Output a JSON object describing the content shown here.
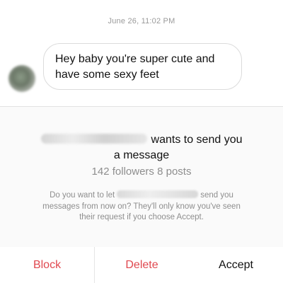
{
  "thread": {
    "timestamp": "June 26, 11:02 PM",
    "message_line1": "Hey baby you're super cute and",
    "message_line2": "have some sexy feet"
  },
  "request": {
    "title_suffix": "wants to send you",
    "title_line2": "a message",
    "followers": "142 followers",
    "posts": "8 posts",
    "desc_part1": "Do you want to let",
    "desc_part2": "send you",
    "desc_line2": "messages from now on? They'll only know you've seen",
    "desc_line3": "their request if you choose Accept."
  },
  "actions": {
    "block": "Block",
    "delete": "Delete",
    "accept": "Accept"
  },
  "colors": {
    "destructive": "#e0484f",
    "secondary_text": "#8e8e8e"
  }
}
